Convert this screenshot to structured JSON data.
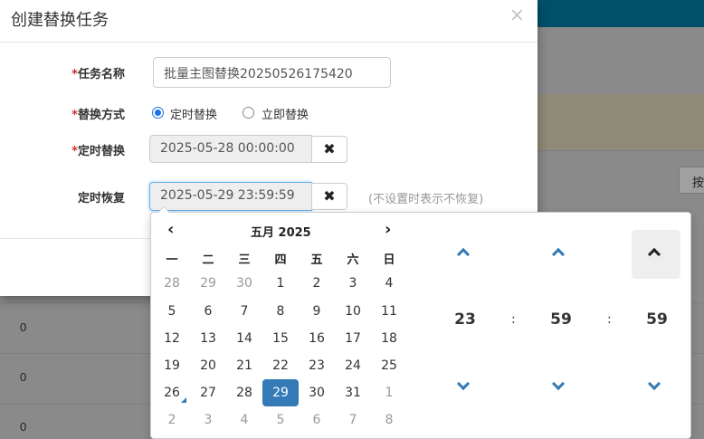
{
  "dialog": {
    "title": "创建替换任务",
    "close": "×",
    "fields": {
      "name_label": "任务名称",
      "name_value": "批量主图替换20250526175420",
      "mode_label": "替换方式",
      "mode_options": [
        "定时替换",
        "立即替换"
      ],
      "mode_selected": "定时替换",
      "schedule_label": "定时替换",
      "schedule_value": "2025-05-28 00:00:00",
      "restore_label": "定时恢复",
      "restore_value": "2025-05-29 23:59:59",
      "restore_hint": "(不设置时表示不恢复)",
      "required_mark": "*",
      "clear_icon": "✖"
    }
  },
  "picker": {
    "prev": "‹",
    "next": "›",
    "month_title": "五月 2025",
    "weekdays": [
      "一",
      "二",
      "三",
      "四",
      "五",
      "六",
      "日"
    ],
    "weeks": [
      [
        "28",
        "29",
        "30",
        "1",
        "2",
        "3",
        "4"
      ],
      [
        "5",
        "6",
        "7",
        "8",
        "9",
        "10",
        "11"
      ],
      [
        "12",
        "13",
        "14",
        "15",
        "16",
        "17",
        "18"
      ],
      [
        "19",
        "20",
        "21",
        "22",
        "23",
        "24",
        "25"
      ],
      [
        "26",
        "27",
        "28",
        "29",
        "30",
        "31",
        "1"
      ],
      [
        "2",
        "3",
        "4",
        "5",
        "6",
        "7",
        "8"
      ]
    ],
    "selected_day": "29",
    "today_day": "26",
    "time": {
      "hour": "23",
      "minute": "59",
      "second": "59",
      "sep": ":"
    }
  },
  "background": {
    "button_text": "按",
    "row_values": [
      "0",
      "0",
      "0"
    ]
  },
  "colors": {
    "header_bar": "#00506a",
    "accent": "#337ab7",
    "required": "#c9302c"
  }
}
